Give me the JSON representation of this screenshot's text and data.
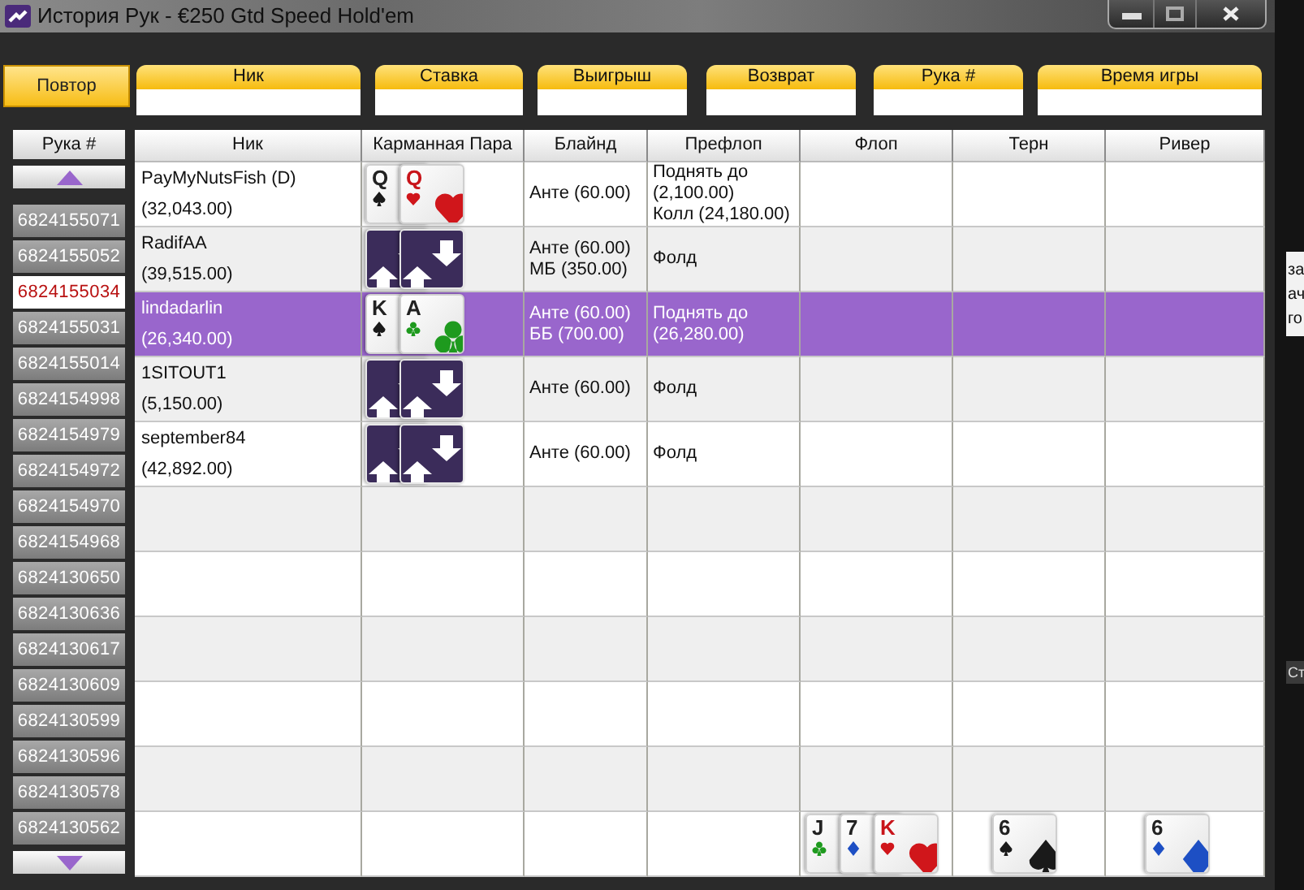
{
  "window": {
    "title": "История Рук - €250 Gtd Speed Hold'em"
  },
  "replay_button": {
    "label": "Повтор"
  },
  "filters": [
    {
      "label": "Ник"
    },
    {
      "label": "Ставка"
    },
    {
      "label": "Выигрыш"
    },
    {
      "label": "Возврат"
    },
    {
      "label": "Рука #"
    },
    {
      "label": "Время игры"
    }
  ],
  "hand_list": {
    "header": "Рука #",
    "items": [
      {
        "label": "6824155071",
        "selected": false
      },
      {
        "label": "6824155052",
        "selected": false
      },
      {
        "label": "6824155034",
        "selected": true
      },
      {
        "label": "6824155031",
        "selected": false
      },
      {
        "label": "6824155014",
        "selected": false
      },
      {
        "label": "6824154998",
        "selected": false
      },
      {
        "label": "6824154979",
        "selected": false
      },
      {
        "label": "6824154972",
        "selected": false
      },
      {
        "label": "6824154970",
        "selected": false
      },
      {
        "label": "6824154968",
        "selected": false
      },
      {
        "label": "6824130650",
        "selected": false
      },
      {
        "label": "6824130636",
        "selected": false
      },
      {
        "label": "6824130617",
        "selected": false
      },
      {
        "label": "6824130609",
        "selected": false
      },
      {
        "label": "6824130599",
        "selected": false
      },
      {
        "label": "6824130596",
        "selected": false
      },
      {
        "label": "6824130578",
        "selected": false
      },
      {
        "label": "6824130562",
        "selected": false
      }
    ]
  },
  "table": {
    "columns": [
      "Ник",
      "Карманная Пара",
      "Блайнд",
      "Префлоп",
      "Флоп",
      "Терн",
      "Ривер"
    ],
    "rows": [
      {
        "player": "PayMyNutsFish (D)",
        "stack": "(32,043.00)",
        "hole_cards": [
          {
            "kind": "spades",
            "rank": "Q"
          },
          {
            "kind": "hearts",
            "rank": "Q"
          }
        ],
        "blind": [
          "Анте (60.00)"
        ],
        "preflop": [
          "Поднять до (2,100.00)",
          "Колл (24,180.00)"
        ],
        "selected": false
      },
      {
        "player": "RadifAA",
        "stack": "(39,515.00)",
        "hole_cards": [
          {
            "kind": "back"
          },
          {
            "kind": "back"
          }
        ],
        "blind": [
          "Анте (60.00)",
          "МБ (350.00)"
        ],
        "preflop": [
          "Фолд"
        ],
        "selected": false
      },
      {
        "player": "lindadarlin",
        "stack": "(26,340.00)",
        "hole_cards": [
          {
            "kind": "spades",
            "rank": "K"
          },
          {
            "kind": "clubs",
            "rank": "A"
          }
        ],
        "blind": [
          "Анте (60.00)",
          "ББ (700.00)"
        ],
        "preflop": [
          "Поднять до (26,280.00)"
        ],
        "selected": true
      },
      {
        "player": "1SITOUT1",
        "stack": "(5,150.00)",
        "hole_cards": [
          {
            "kind": "back"
          },
          {
            "kind": "back"
          }
        ],
        "blind": [
          "Анте (60.00)"
        ],
        "preflop": [
          "Фолд"
        ],
        "selected": false
      },
      {
        "player": "september84",
        "stack": "(42,892.00)",
        "hole_cards": [
          {
            "kind": "back"
          },
          {
            "kind": "back"
          }
        ],
        "blind": [
          "Анте (60.00)"
        ],
        "preflop": [
          "Фолд"
        ],
        "selected": false
      }
    ],
    "board": {
      "flop": [
        {
          "kind": "clubs",
          "rank": "J"
        },
        {
          "kind": "diamonds",
          "rank": "7"
        },
        {
          "kind": "hearts",
          "rank": "K"
        }
      ],
      "turn": [
        {
          "kind": "spades",
          "rank": "6"
        }
      ],
      "river": [
        {
          "kind": "diamonds",
          "rank": "6"
        }
      ]
    }
  },
  "background_window": {
    "texts": [
      "за",
      "ач",
      "го",
      "Ст"
    ]
  }
}
